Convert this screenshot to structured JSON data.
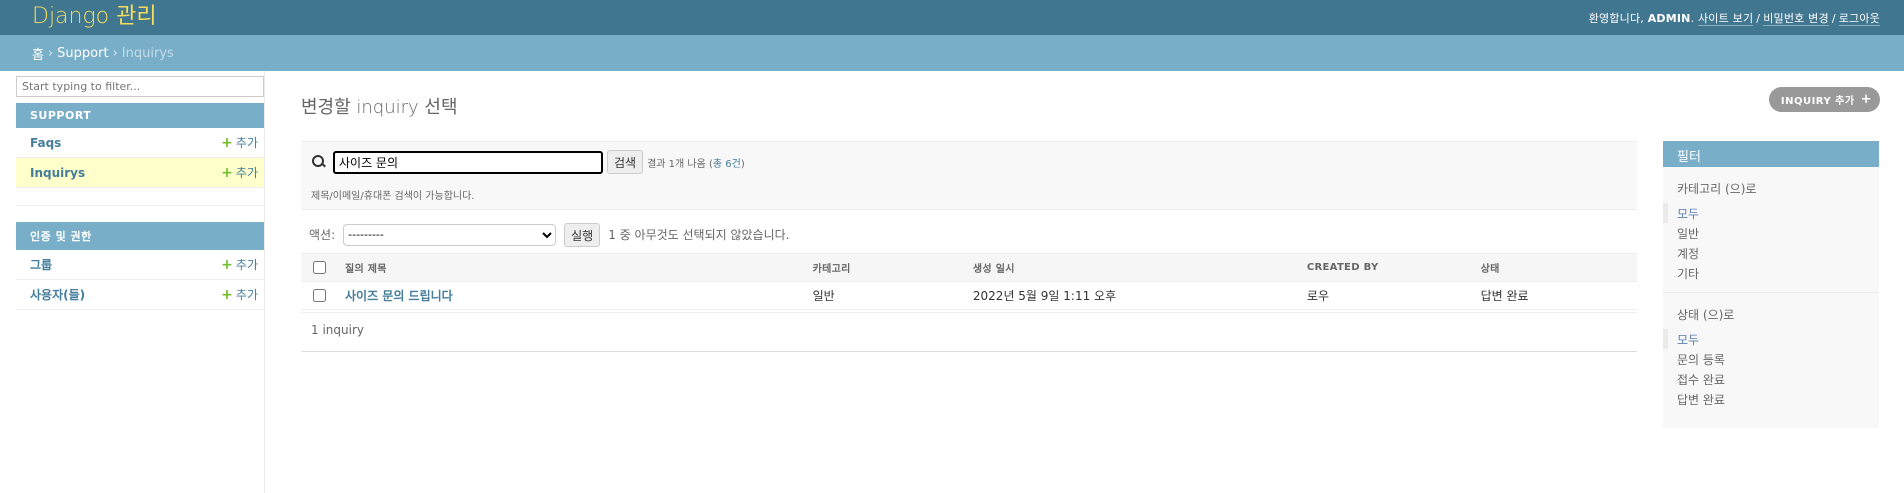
{
  "header": {
    "branding": "Django 관리",
    "welcome": "환영합니다,",
    "username": "ADMIN",
    "links": [
      "사이트 보기",
      "비밀번호 변경",
      "로그아웃"
    ]
  },
  "breadcrumbs": [
    "홈",
    "Support",
    "Inquirys"
  ],
  "sidebar": {
    "filter_placeholder": "Start typing to filter...",
    "modules": [
      {
        "caption": "Support",
        "rows": [
          {
            "label": "Faqs",
            "add": "추가"
          },
          {
            "label": "Inquirys",
            "add": "추가"
          }
        ]
      },
      {
        "caption": "인증 및 권한",
        "rows": [
          {
            "label": "그룹",
            "add": "추가"
          },
          {
            "label": "사용자(들)",
            "add": "추가"
          }
        ]
      }
    ]
  },
  "content": {
    "title": "변경할 inquiry 선택",
    "add_button": "INQUIRY 추가",
    "search": {
      "value": "사이즈 문의",
      "button": "검색",
      "result_prefix": "결과 1개 나옴 (",
      "result_total": "총 6건",
      "result_suffix": ")",
      "help": "제목/이메일/휴대폰 검색이 가능합니다."
    },
    "actions": {
      "label": "액션:",
      "selected": "---------",
      "go": "실행",
      "counter": "1 중 아무것도 선택되지 않았습니다."
    },
    "table": {
      "columns": [
        "질의 제목",
        "카테고리",
        "생성 일시",
        "CREATED BY",
        "상태"
      ],
      "rows": [
        [
          "사이즈 문의 드립니다",
          "일반",
          "2022년 5월 9일 1:11 오후",
          "로우",
          "답변 완료"
        ]
      ]
    },
    "paginator": "1 inquiry"
  },
  "filter": {
    "title": "필터",
    "groups": [
      {
        "heading": "카테고리 (으)로",
        "items": [
          "모두",
          "일반",
          "계정",
          "기타"
        ],
        "selected": 0
      },
      {
        "heading": "상태 (으)로",
        "items": [
          "모두",
          "문의 등록",
          "접수 완료",
          "답변 완료"
        ],
        "selected": 0
      }
    ]
  }
}
